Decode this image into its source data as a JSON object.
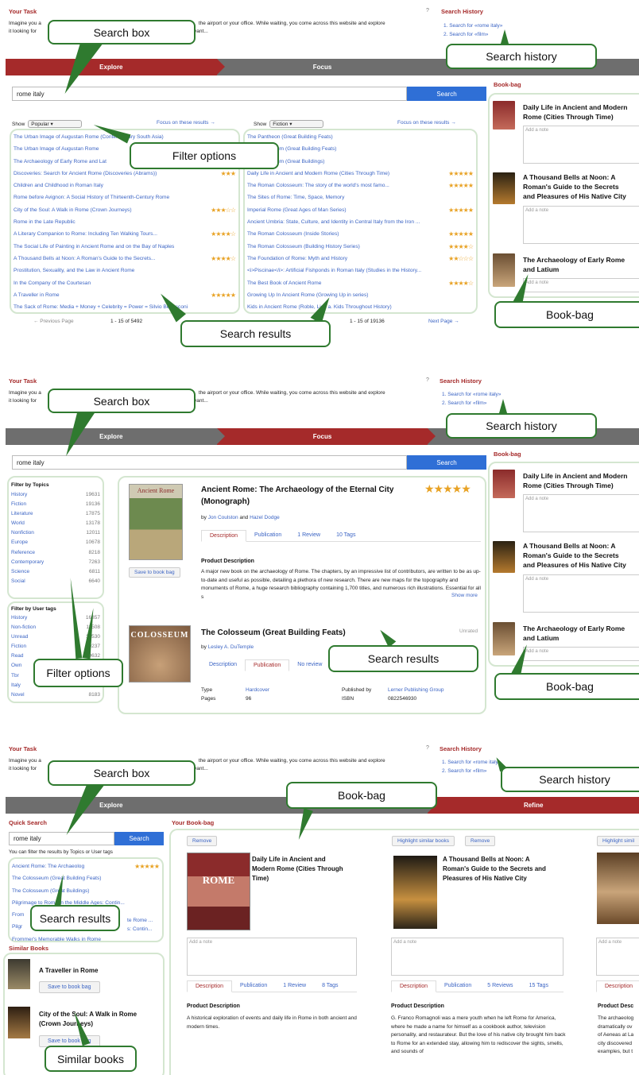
{
  "common": {
    "your_task": "Your Task",
    "help": "?",
    "task_text_l1_a": "Imagine you a",
    "task_text_l1_b": "the airport or your office. While waiting, you come across this website and explore",
    "task_text_l2_a": "it looking for",
    "task_text_l2_b": "vant...",
    "search_history_title": "Search History",
    "history": [
      "1. Search for «rome italy»",
      "2. Search for «film»"
    ],
    "query": "rome italy",
    "search_label": "Search",
    "bookbag_title": "Book-bag",
    "add_note": "Add a note"
  },
  "panel1": {
    "steps": [
      "Explore",
      "Focus",
      ""
    ],
    "show_label": "Show",
    "left_select": "Popular",
    "right_select": "Fiction",
    "focus_link": "Focus on these results →",
    "left_results": [
      {
        "t": "The Urban Image of Augustan Rome (Contemporary South Asia)",
        "s": ""
      },
      {
        "t": "The Urban Image of Augustan Rome",
        "s": ""
      },
      {
        "t": "The Archaeology of Early Rome and Lat",
        "s": ""
      },
      {
        "t": "Discoveries: Search for Ancient Rome (Discoveries (Abrams))",
        "s": "★★★"
      },
      {
        "t": "Children and Childhood in Roman Italy",
        "s": ""
      },
      {
        "t": "Rome before Avignon: A Social History of Thirteenth-Century Rome",
        "s": ""
      },
      {
        "t": "City of the Soul: A Walk in Rome (Crown Journeys)",
        "s": "★★★☆☆"
      },
      {
        "t": "Rome in the Late Republic",
        "s": ""
      },
      {
        "t": "A Literary Companion to Rome: Including Ten Walking Tours...",
        "s": "★★★★☆"
      },
      {
        "t": "The Social Life of Painting in Ancient Rome and on the Bay of Naples",
        "s": ""
      },
      {
        "t": "A Thousand Bells at Noon: A Roman's Guide to the Secrets...",
        "s": "★★★★☆"
      },
      {
        "t": "Prostitution, Sexuality, and the Law in Ancient Rome",
        "s": ""
      },
      {
        "t": "In the Company of the Courtesan",
        "s": ""
      },
      {
        "t": "A Traveller in Rome",
        "s": "★★★★★"
      },
      {
        "t": "The Sack of Rome: Media + Money + Celebrity = Power = Silvio Berlusconi",
        "s": ""
      }
    ],
    "right_results": [
      {
        "t": "The Pantheon (Great Building Feats)",
        "s": ""
      },
      {
        "t": "The Colosseum (Great Building Feats)",
        "s": ""
      },
      {
        "t": "The Colosseum (Great Buildings)",
        "s": ""
      },
      {
        "t": "Daily Life in Ancient and Modern Rome (Cities Through Time)",
        "s": "★★★★★"
      },
      {
        "t": "The Roman Colosseum: The story of the world's most famo...",
        "s": "★★★★★"
      },
      {
        "t": "The Sites of Rome: Time, Space, Memory",
        "s": ""
      },
      {
        "t": "Imperial Rome (Great Ages of Man Series)",
        "s": "★★★★★"
      },
      {
        "t": "Ancient Umbria: State, Culture, and Identity in Central Italy from the Iron ...",
        "s": ""
      },
      {
        "t": "The Roman Colosseum (Inside Stories)",
        "s": "★★★★★"
      },
      {
        "t": "The Roman Colosseum (Building History Series)",
        "s": "★★★★☆"
      },
      {
        "t": "The Foundation of Rome: Myth and History",
        "s": "★★☆☆☆"
      },
      {
        "t": "<i>Piscinae</i>: Artificial Fishponds in Roman Italy (Studies in the History...",
        "s": ""
      },
      {
        "t": "The Best Book of Ancient Rome",
        "s": "★★★★☆"
      },
      {
        "t": "Growing Up In Ancient Rome (Growing Up in series)",
        "s": ""
      },
      {
        "t": "Kids in Ancient Rome (Roble, Lisa a. Kids Throughout History)",
        "s": ""
      }
    ],
    "prev_page": "← Previous Page",
    "left_count": "1 - 15 of 5492",
    "right_count": "1 - 15 of 19136",
    "next_page": "Next Page →",
    "bookbag": [
      {
        "title": "Daily Life in Ancient and Modern\nRome (Cities Through Time)"
      },
      {
        "title": "A Thousand Bells at Noon: A\nRoman's Guide to the Secrets\nand Pleasures of His Native City"
      },
      {
        "title": "The Archaeology of Early Rome\nand Latium"
      }
    ],
    "callouts": {
      "search_box": "Search box",
      "search_history": "Search history",
      "filter_options": "Filter options",
      "search_results": "Search results",
      "bookbag": "Book-bag"
    }
  },
  "panel2": {
    "steps": [
      "Explore",
      "Focus",
      ""
    ],
    "filter_topics_title": "Filter by Topics",
    "topics": [
      {
        "n": "History",
        "c": "19631"
      },
      {
        "n": "Fiction",
        "c": "19136"
      },
      {
        "n": "Literature",
        "c": "17875"
      },
      {
        "n": "World",
        "c": "13178"
      },
      {
        "n": "Nonfiction",
        "c": "12011"
      },
      {
        "n": "Europe",
        "c": "10678"
      },
      {
        "n": "Reference",
        "c": "8218"
      },
      {
        "n": "Contemporary",
        "c": "7263"
      },
      {
        "n": "Science",
        "c": "6811"
      },
      {
        "n": "Social",
        "c": "6640"
      }
    ],
    "filter_tags_title": "Filter by User tags",
    "tags": [
      {
        "n": "History",
        "c": "16857"
      },
      {
        "n": "Non-fiction",
        "c": "11508"
      },
      {
        "n": "Unread",
        "c": "10530"
      },
      {
        "n": "Fiction",
        "c": "10237"
      },
      {
        "n": "Read",
        "c": "9632"
      },
      {
        "n": "Own",
        "c": "9401"
      },
      {
        "n": "Tbr",
        "c": "9275"
      },
      {
        "n": "Italy",
        "c": "8190"
      },
      {
        "n": "Novel",
        "c": "8183"
      }
    ],
    "book1": {
      "title_l1": "Ancient Rome: The Archaeology of the Eternal City",
      "title_l2": "(Monograph)",
      "by": "by",
      "author1": "Jon Coulston",
      "and": "and",
      "author2": "Hazel Dodge",
      "stars": "★★★★★",
      "tabs": [
        "Description",
        "Publication",
        "1 Review",
        "10 Tags"
      ],
      "desc_title": "Product Description",
      "desc": "A major new book on the archaeology of Rome. The chapters, by an impressive list of contributors, are written to be as up-to-date and useful as possible, detailing a plethora of new research. There are new maps for the topography and monuments of Rome, a huge research bibliography containing 1,700 titles, and numerous rich illustrations. Essential for all s",
      "show_more": "Show more",
      "save": "Save to book bag",
      "cover_text": "Ancient Rome"
    },
    "book2": {
      "title": "The Colosseum (Great Building Feats)",
      "unrated": "Unrated",
      "by": "by",
      "author": "Lesley A. DuTemple",
      "tabs": [
        "Description",
        "Publication",
        "No review"
      ],
      "type_label": "Type",
      "type_value": "Hardcover",
      "pages_label": "Pages",
      "pages_value": "96",
      "publisher_label": "Published by",
      "publisher_value": "Lerner Publishing Group",
      "isbn_label": "ISBN",
      "isbn_value": "0822546930",
      "cover_text": "COLOSSEUM"
    },
    "bookbag": [
      {
        "title": "Daily Life in Ancient and Modern\nRome (Cities Through Time)"
      },
      {
        "title": "A Thousand Bells at Noon: A\nRoman's Guide to the Secrets\nand Pleasures of His Native City"
      },
      {
        "title": "The Archaeology of Early Rome\nand Latium"
      }
    ],
    "callouts": {
      "search_box": "Search box",
      "search_history": "Search history",
      "filter_options": "Filter options",
      "search_results": "Search results",
      "bookbag": "Book-bag"
    }
  },
  "panel3": {
    "steps": [
      "Explore",
      "",
      "Refine"
    ],
    "quick_search_title": "Quick Search",
    "filter_hint": "You can filter the results by Topics or User tags",
    "results": [
      {
        "t": "Ancient Rome: The Archaeolog",
        "s": "★★★★★"
      },
      {
        "t": "The Colosseum (Great Building Feats)",
        "s": ""
      },
      {
        "t": "The Colosseum (Great Buildings)",
        "s": ""
      },
      {
        "t": "Pilgrimage to Rome in the Middle Ages: Contin...",
        "s": ""
      },
      {
        "t": "From",
        "s": ""
      },
      {
        "t": "Pilgr",
        "s": ""
      },
      {
        "t": "Frommer's Memorable Walks in Rome",
        "s": ""
      }
    ],
    "results_tail_1": "te Rome ...",
    "results_tail_2": "s: Contin...",
    "similar_title": "Similar Books",
    "similar": [
      {
        "title_l1": "A Traveller in Rome",
        "title_l2": ""
      },
      {
        "title_l1": "City of the Soul: A Walk in Rome",
        "title_l2": "(Crown Journeys)"
      }
    ],
    "save": "Save to book bag",
    "your_bookbag": "Your Book-bag",
    "remove": "Remove",
    "highlight": "Highlight similar books",
    "highlight_cut": "Highlight simil",
    "book1": {
      "title": "Daily Life in Ancient and\nModern Rome (Cities Through\nTime)",
      "tabs": [
        "Description",
        "Publication",
        "1 Review",
        "8 Tags"
      ],
      "desc_title": "Product Description",
      "desc": "A historical exploration of events and daily life in Rome in both ancient and modern times.",
      "cover_text": "ROME"
    },
    "book2": {
      "title": "A Thousand Bells at Noon: A\nRoman's Guide to the Secrets and\nPleasures of His Native City",
      "tabs": [
        "Description",
        "Publication",
        "5 Reviews",
        "15 Tags"
      ],
      "desc_title": "Product Description",
      "desc": "G. Franco Romagnoli was a mere youth when he left Rome for America, where he made a name for himself as a cookbook author, television personality, and restaurateur. But the love of his native city brought him back to Rome for an extended stay, allowing him to rediscover the sights, smells, and sounds of"
    },
    "book3": {
      "tab": "Description",
      "desc_title": "Product Desc",
      "desc": "The archaeolog\ndramatically ov\nof Aeneas at La\ncity discovered\nexamples, but t"
    },
    "callouts": {
      "search_box": "Search box",
      "search_history": "Search history",
      "bookbag": "Book-bag",
      "search_results": "Search results",
      "similar_books": "Similar books"
    }
  },
  "colors": {
    "accent": "#a52a2a",
    "link": "#3b64c4",
    "button": "#2f6fd6",
    "step_off": "#6e6e6e",
    "callout_border": "#2f7a2f"
  }
}
